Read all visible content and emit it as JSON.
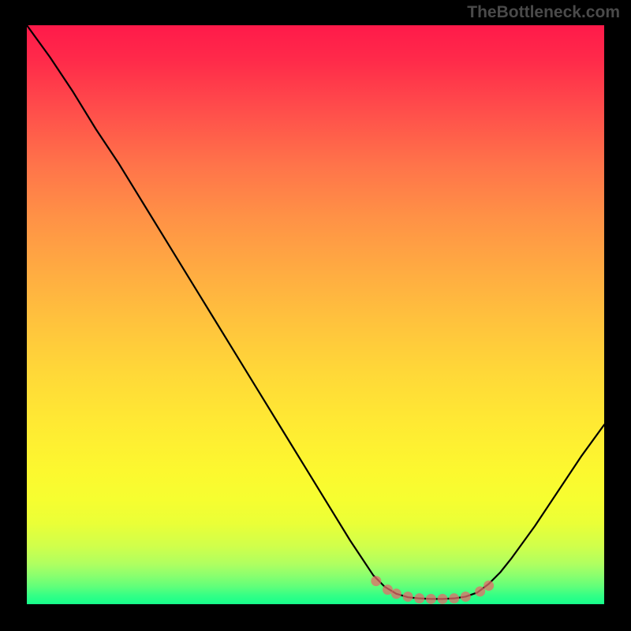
{
  "watermark": "TheBottleneck.com",
  "chart_data": {
    "type": "line",
    "title": "",
    "xlabel": "",
    "ylabel": "",
    "x_range": [
      0,
      100
    ],
    "y_range": [
      0,
      100
    ],
    "series": [
      {
        "name": "curve",
        "points": [
          [
            0.0,
            100.0
          ],
          [
            4.0,
            94.5
          ],
          [
            8.0,
            88.5
          ],
          [
            12.0,
            82.0
          ],
          [
            16.0,
            76.0
          ],
          [
            20.0,
            69.5
          ],
          [
            24.0,
            63.0
          ],
          [
            28.0,
            56.5
          ],
          [
            32.0,
            50.0
          ],
          [
            36.0,
            43.5
          ],
          [
            40.0,
            37.0
          ],
          [
            44.0,
            30.5
          ],
          [
            48.0,
            24.0
          ],
          [
            52.0,
            17.5
          ],
          [
            56.0,
            11.0
          ],
          [
            58.0,
            8.0
          ],
          [
            60.0,
            5.0
          ],
          [
            62.0,
            3.0
          ],
          [
            64.0,
            1.8
          ],
          [
            66.0,
            1.2
          ],
          [
            68.0,
            1.0
          ],
          [
            70.0,
            0.9
          ],
          [
            72.0,
            0.9
          ],
          [
            74.0,
            1.0
          ],
          [
            76.0,
            1.3
          ],
          [
            78.0,
            2.0
          ],
          [
            80.0,
            3.5
          ],
          [
            82.0,
            5.5
          ],
          [
            84.0,
            8.0
          ],
          [
            88.0,
            13.5
          ],
          [
            92.0,
            19.5
          ],
          [
            96.0,
            25.5
          ],
          [
            100.0,
            31.0
          ]
        ]
      }
    ],
    "markers": [
      [
        60.5,
        4.0
      ],
      [
        62.5,
        2.5
      ],
      [
        64.0,
        1.8
      ],
      [
        66.0,
        1.3
      ],
      [
        68.0,
        1.0
      ],
      [
        70.0,
        0.9
      ],
      [
        72.0,
        0.9
      ],
      [
        74.0,
        1.0
      ],
      [
        76.0,
        1.3
      ],
      [
        78.5,
        2.2
      ],
      [
        80.0,
        3.2
      ]
    ],
    "note": "x and y are abstract 0–100 coordinates; y=0 is the bottom (green) and y=100 is the top (red). Values are read from the curve's vertical position within the gradient."
  }
}
